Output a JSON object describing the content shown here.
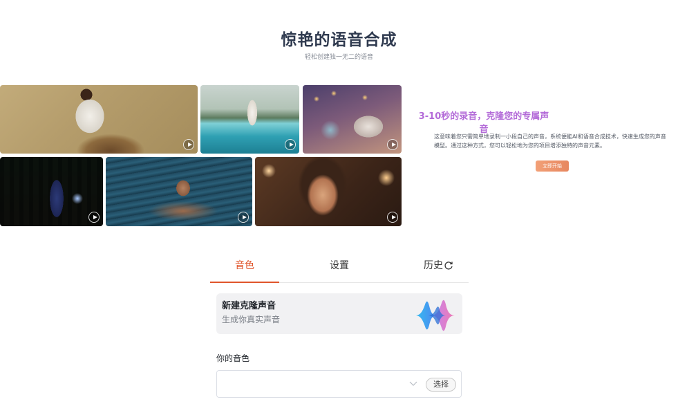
{
  "hero": {
    "title": "惊艳的语音合成",
    "subtitle": "轻松创建独一无二的语音"
  },
  "gallery": [
    {
      "icon": "play-icon"
    },
    {
      "icon": "play-icon"
    },
    {
      "icon": "play-icon"
    },
    {
      "icon": "play-icon"
    },
    {
      "icon": "play-icon"
    },
    {
      "icon": "play-icon"
    }
  ],
  "promo": {
    "title": "3-10秒的录音，克隆您的专属声音",
    "description": "这意味着您只需简单地录制一小段自己的声音，系统便能AI和语音合成技术，快速生成您的声音模型。通过这种方式，您可以轻松地为您的项目增添独特的声音元素。",
    "button_label": "立即开始",
    "accent": "#b36ad8",
    "button_color": "#ec9168"
  },
  "tabs": {
    "items": [
      {
        "label": "音色",
        "active": true
      },
      {
        "label": "设置",
        "active": false
      },
      {
        "label": "历史",
        "active": false
      }
    ],
    "accent": "#e0552b",
    "history_icon": "refresh-icon"
  },
  "clone_card": {
    "title": "新建克隆声音",
    "subtitle": "生成你真实声音",
    "icon": "sound-wave-icon"
  },
  "your_voice": {
    "label": "你的音色",
    "value": "",
    "select_button": "选择",
    "dropdown_icon": "chevron-down-icon"
  }
}
